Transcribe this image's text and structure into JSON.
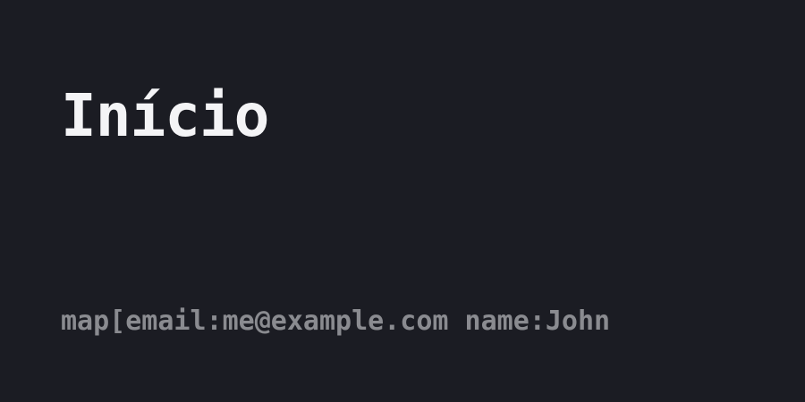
{
  "header": {
    "title": "Início"
  },
  "main": {
    "output_text": "map[email:me@example.com name:John"
  },
  "colors": {
    "background": "#1b1c23",
    "title": "#f4f4f6",
    "output_text": "#8a8b90"
  }
}
